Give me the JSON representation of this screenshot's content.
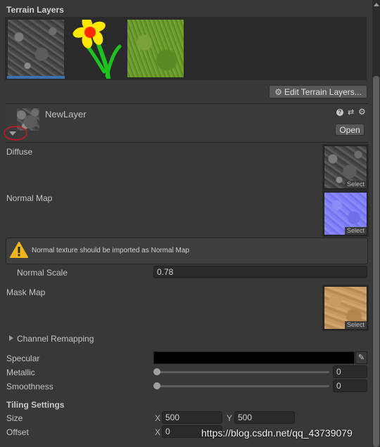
{
  "header": {
    "title": "Terrain Layers"
  },
  "layers_panel": {
    "edit_button": "Edit Terrain Layers...",
    "thumbnails": [
      "rock-texture",
      "flower-icon",
      "grass-texture"
    ]
  },
  "layer": {
    "name": "NewLayer",
    "open_button": "Open",
    "icons": [
      "help-icon",
      "presets-icon",
      "gear-icon"
    ]
  },
  "properties": {
    "diffuse_label": "Diffuse",
    "normal_map_label": "Normal Map",
    "mask_map_label": "Mask Map",
    "select_label": "Select",
    "warning_text": "Normal texture should be imported as Normal Map",
    "normal_scale_label": "Normal Scale",
    "normal_scale_value": "0.78",
    "channel_remapping_label": "Channel Remapping",
    "specular_label": "Specular",
    "specular_color": "#000000",
    "metallic_label": "Metallic",
    "metallic_value": "0",
    "metallic_level": 0,
    "smoothness_label": "Smoothness",
    "smoothness_value": "0",
    "smoothness_level": 0
  },
  "tiling": {
    "title": "Tiling Settings",
    "size_label": "Size",
    "size_x": "500",
    "size_y": "500",
    "offset_label": "Offset",
    "offset_x": "0",
    "x_label": "X",
    "y_label": "Y"
  },
  "watermark": "https://blog.csdn.net/qq_43739079",
  "colors": {
    "background": "#383838",
    "selection_accent": "#3a72b0",
    "annotation_red": "#d0141c",
    "warning_yellow": "#f2b51c"
  }
}
